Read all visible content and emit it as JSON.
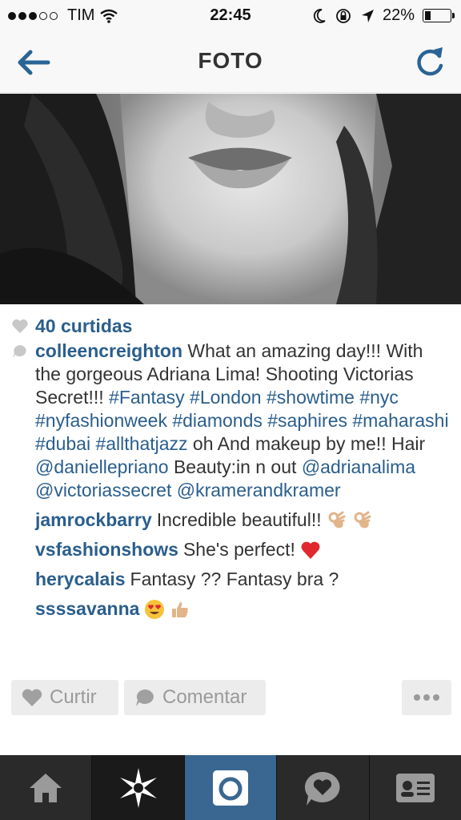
{
  "status_bar": {
    "carrier": "TIM",
    "time": "22:45",
    "battery": "22%",
    "battery_level": 0.22,
    "signal_bars_filled": 3,
    "signal_bars_total": 5
  },
  "nav": {
    "title": "FOTO",
    "back_icon": "arrow-left-icon",
    "refresh_icon": "refresh-icon",
    "accent_color": "#2a6496"
  },
  "post": {
    "likes": "40 curtidas",
    "caption": {
      "username": "colleencreighton",
      "segments": [
        {
          "text": " What an amazing day!!! With the gorgeous Adriana Lima! Shooting Victorias Secret!!! "
        },
        {
          "text": "#Fantasy",
          "tag": true
        },
        {
          "text": " "
        },
        {
          "text": "#London",
          "tag": true
        },
        {
          "text": " "
        },
        {
          "text": "#showtime",
          "tag": true
        },
        {
          "text": " "
        },
        {
          "text": "#nyc",
          "tag": true
        },
        {
          "text": " "
        },
        {
          "text": "#nyfashionweek",
          "tag": true
        },
        {
          "text": " "
        },
        {
          "text": "#diamonds",
          "tag": true
        },
        {
          "text": " "
        },
        {
          "text": "#saphires",
          "tag": true
        },
        {
          "text": " "
        },
        {
          "text": "#maharashi",
          "tag": true
        },
        {
          "text": " "
        },
        {
          "text": "#dubai",
          "tag": true
        },
        {
          "text": " "
        },
        {
          "text": "#allthatjazz",
          "tag": true
        },
        {
          "text": " oh And makeup by me!! Hair "
        },
        {
          "text": "@daniellepriano",
          "tag": true
        },
        {
          "text": " Beauty:in n out "
        },
        {
          "text": "@adrianalima",
          "tag": true
        },
        {
          "text": " "
        },
        {
          "text": "@victoriassecret",
          "tag": true
        },
        {
          "text": " "
        },
        {
          "text": "@kramerandkramer",
          "tag": true
        }
      ]
    },
    "comments": [
      {
        "username": "jamrockbarry",
        "text": "Incredible beautiful!!",
        "emojis": [
          "ok-hand-emoji",
          "ok-hand-emoji"
        ]
      },
      {
        "username": "vsfashionshows",
        "text": "She's perfect!",
        "emojis": [
          "red-heart-emoji"
        ]
      },
      {
        "username": "herycalais",
        "text": "Fantasy ?? Fantasy bra ?",
        "emojis": []
      },
      {
        "username": "ssssavanna",
        "text": "",
        "emojis": [
          "heart-eyes-emoji",
          "thumbs-up-emoji"
        ]
      }
    ]
  },
  "actions": {
    "like_label": "Curtir",
    "comment_label": "Comentar",
    "more_icon": "more-dots-icon"
  },
  "tabs": [
    {
      "name": "home",
      "icon": "home-icon",
      "active": false
    },
    {
      "name": "explore",
      "icon": "explore-star-icon",
      "active": false
    },
    {
      "name": "camera",
      "icon": "camera-icon",
      "active": true
    },
    {
      "name": "activity",
      "icon": "activity-heart-icon",
      "active": false
    },
    {
      "name": "profile",
      "icon": "profile-card-icon",
      "active": false
    }
  ]
}
